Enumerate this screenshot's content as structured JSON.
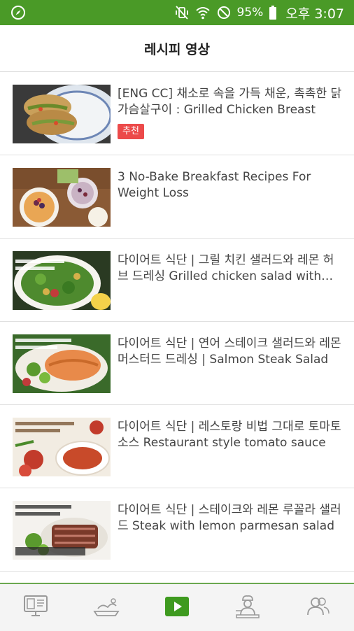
{
  "status_bar": {
    "battery": "95%",
    "time": "오후 3:07",
    "icons": [
      "compass-icon",
      "vibrate-mute-icon",
      "wifi-icon",
      "do-not-disturb-icon",
      "battery-icon"
    ]
  },
  "header": {
    "title": "레시피 영상"
  },
  "videos": [
    {
      "title": "[ENG CC] 채소로 속을 가득 채운, 촉촉한 닭가슴살구이 : Grilled Chicken Breast",
      "badge": "추천"
    },
    {
      "title": "3 No-Bake Breakfast Recipes For Weight Loss"
    },
    {
      "title": "다이어트 식단 | 그릴 치킨 샐러드와 레몬 허브 드레싱 Grilled chicken salad with lemon herb dressing"
    },
    {
      "title": "다이어트 식단 | 연어 스테이크 샐러드와 레몬 머스터드 드레싱 | Salmon Steak Salad"
    },
    {
      "title": "다이어트 식단 | 레스토랑 비법 그대로 토마토 소스 Restaurant style tomato sauce"
    },
    {
      "title": "다이어트 식단 | 스테이크와 레몬 루꼴라 샐러드 Steak with lemon parmesan salad"
    }
  ],
  "bottom_nav": {
    "items": [
      "monitor-icon",
      "scale-icon",
      "video-play-icon",
      "chef-icon",
      "people-icon"
    ],
    "active": "video-play-icon",
    "active_color": "#3e9a1f",
    "inactive_color": "#9a9a9a"
  },
  "colors": {
    "status_bar": "#4a9a27",
    "badge": "#ec4a4a",
    "accent": "#6aa84f"
  }
}
